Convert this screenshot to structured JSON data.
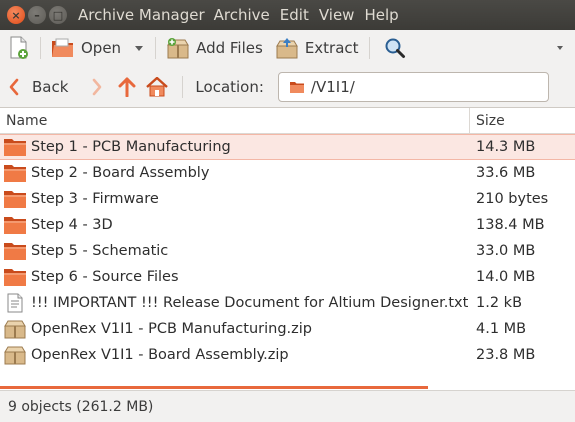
{
  "window": {
    "title": "Archive Manager",
    "menu": [
      "Archive",
      "Edit",
      "View",
      "Help"
    ]
  },
  "toolbar": {
    "open_label": "Open",
    "add_files_label": "Add Files",
    "extract_label": "Extract"
  },
  "location": {
    "back_label": "Back",
    "label": "Location:",
    "path": "/V1I1/"
  },
  "columns": {
    "name": "Name",
    "size": "Size"
  },
  "files": [
    {
      "name": "Step 1 - PCB Manufacturing",
      "size": "14.3 MB",
      "type": "folder",
      "selected": true
    },
    {
      "name": "Step 2 - Board Assembly",
      "size": "33.6 MB",
      "type": "folder"
    },
    {
      "name": "Step 3 - Firmware",
      "size": "210 bytes",
      "type": "folder"
    },
    {
      "name": "Step 4 - 3D",
      "size": "138.4 MB",
      "type": "folder"
    },
    {
      "name": "Step 5 - Schematic",
      "size": "33.0 MB",
      "type": "folder"
    },
    {
      "name": "Step 6 - Source Files",
      "size": "14.0 MB",
      "type": "folder"
    },
    {
      "name": "!!! IMPORTANT !!! Release Document for Altium Designer.txt",
      "size": "1.2 kB",
      "type": "text"
    },
    {
      "name": "OpenRex V1I1 - PCB Manufacturing.zip",
      "size": "4.1 MB",
      "type": "zip"
    },
    {
      "name": "OpenRex V1I1 - Board Assembly.zip",
      "size": "23.8 MB",
      "type": "zip"
    }
  ],
  "status": {
    "text": "9 objects (261.2 MB)"
  },
  "colors": {
    "accent": "#e8683c",
    "folder": "#e95420",
    "selection": "#fbe7e2"
  }
}
